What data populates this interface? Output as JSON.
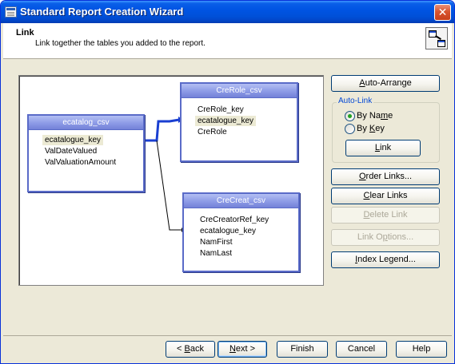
{
  "window": {
    "title": "Standard Report Creation Wizard",
    "close_glyph": "✕"
  },
  "header": {
    "title": "Link",
    "subtitle": "Link together the tables you added to the report.",
    "icon": "link-tables-icon"
  },
  "tables": [
    {
      "name": "ecatalog_csv",
      "fields": [
        "ecatalogue_key",
        "ValDateValued",
        "ValValuationAmount"
      ],
      "highlighted_field": "ecatalogue_key"
    },
    {
      "name": "CreRole_csv",
      "fields": [
        "CreRole_key",
        "ecatalogue_key",
        "CreRole"
      ],
      "highlighted_field": "ecatalogue_key"
    },
    {
      "name": "CreCreat_csv",
      "fields": [
        "CreCreatorRef_key",
        "ecatalogue_key",
        "NamFirst",
        "NamLast"
      ],
      "highlighted_field": ""
    }
  ],
  "links": [
    {
      "from": "ecatalog_csv.ecatalogue_key",
      "to": "CreRole_csv.ecatalogue_key",
      "selected": true
    },
    {
      "from": "ecatalog_csv.ecatalogue_key",
      "to": "CreCreat_csv.ecatalogue_key",
      "selected": false
    }
  ],
  "side": {
    "auto_arrange": {
      "pre": "",
      "mnemonic": "A",
      "post": "uto-Arrange"
    },
    "auto_link_label": "Auto-Link",
    "by_name": {
      "pre": "By Na",
      "mnemonic": "m",
      "post": "e",
      "selected": true
    },
    "by_key": {
      "pre": "By ",
      "mnemonic": "K",
      "post": "ey",
      "selected": false
    },
    "link_btn": {
      "pre": "",
      "mnemonic": "L",
      "post": "ink"
    },
    "order_links": {
      "pre": "",
      "mnemonic": "O",
      "post": "rder Links..."
    },
    "clear_links": {
      "pre": "",
      "mnemonic": "C",
      "post": "lear Links"
    },
    "delete_link": {
      "pre": "",
      "mnemonic": "D",
      "post": "elete Link"
    },
    "link_options": {
      "pre": "Link O",
      "mnemonic": "p",
      "post": "tions..."
    },
    "index_legend": {
      "pre": "",
      "mnemonic": "I",
      "post": "ndex Legend..."
    }
  },
  "footer": {
    "back": {
      "pre": "< ",
      "mnemonic": "B",
      "post": "ack"
    },
    "next": {
      "pre": "",
      "mnemonic": "N",
      "post": "ext >"
    },
    "finish": "Finish",
    "cancel": "Cancel",
    "help": "Help"
  },
  "colors": {
    "selected_link": "#1a3fd1",
    "table_border": "#5a6bc8",
    "titlebar": "#0054e3"
  }
}
